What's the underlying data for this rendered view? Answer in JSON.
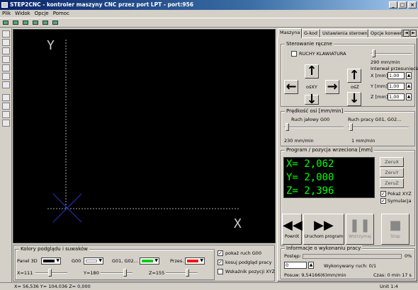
{
  "window": {
    "title": "STEP2CNC - kontroler maszyny CNC przez port LPT - port:956",
    "minimize": "_",
    "maximize": "□",
    "close": "×"
  },
  "menu": [
    "Plik",
    "Widok",
    "Opcje",
    "Pomoc"
  ],
  "canvas": {
    "axis_y": "Y",
    "axis_x": "X"
  },
  "colors_panel": {
    "legend": "Kolory podglądu i suwaków",
    "panel3d": "Panel 3D",
    "g00": "G00",
    "g01": "G01, G02...",
    "przes": "Przes.",
    "swatches": {
      "panel3d": "#000000",
      "g00": "#ffffff",
      "g01": "#00cc00",
      "przes": "#ff0000"
    },
    "x_label": "X=111",
    "y_label": "Y=180",
    "z_label": "Z=155",
    "cb_g00": "pokaż ruch G00",
    "cb_podglad": "kosuj podgląd pracy",
    "cb_wskaznik": "Wskaźnik pozycji XYZ"
  },
  "tabs": [
    "Maszyna",
    "G-kod",
    "Ustawienia sterownika",
    "Opcje konwersji"
  ],
  "manual": {
    "legend": "Sterowanie ręczne",
    "keyboard": "RUCHY KLAWIATURA",
    "speed": "290 mm/min",
    "interval_label": "Interwał przesunięcia",
    "osxy": "ośXY",
    "osz": "ośZ",
    "x_label": "X [mm]",
    "x_val": "1,00",
    "y_label": "Y [mm]",
    "y_val": "1,00",
    "z_label": "Z [mm]",
    "z_val": "1,00"
  },
  "feed": {
    "legend": "Prędkość osi [mm/min]",
    "g00_label": "Ruch jałowy G00",
    "g01_label": "Ruch pracy G01, G02...",
    "g00_val": "230 mm/min",
    "g01_val": "1 mm/min"
  },
  "program": {
    "legend": "Program / pozycja wrzeciona [mm]",
    "x": "X= 2,062",
    "y": "Y= 2,000",
    "z": "Z= 2,396",
    "zeru_x": "ZeruX",
    "zeru_y": "ZeruY",
    "zeru_z": "ZeruZ",
    "cb_pokaz": "Pokaż XYZ",
    "cb_sym": "Symulacja",
    "btn_powrot": "Powrót",
    "btn_uruchom": "Uruchom program",
    "btn_wstrzymaj": "Wstrzymaj",
    "btn_stop": "Stop"
  },
  "info": {
    "legend": "Informacje o wykonaniu pracy",
    "postep": "Postęp:",
    "percent": "0%",
    "line_val": "0",
    "wykonywany": "Wykonywany ruch: 0/1",
    "posuw": "Posuw: 9,54166(6)mm/min",
    "czas": "Czas: 0 min 17 s"
  },
  "status": {
    "coords": "X= 56,536  Y= 104,036  Z=   0,000",
    "unit": "Unit 1:4"
  }
}
